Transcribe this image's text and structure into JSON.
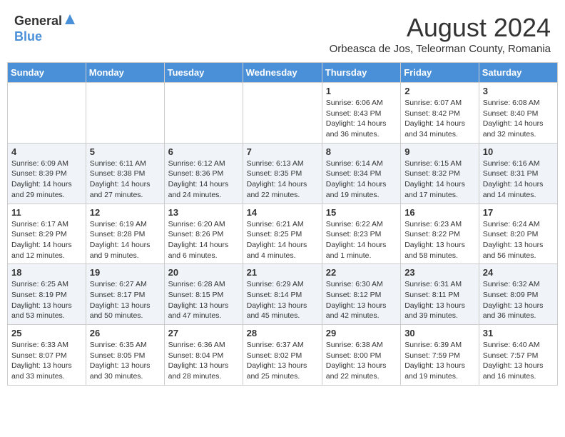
{
  "header": {
    "logo_general": "General",
    "logo_blue": "Blue",
    "main_title": "August 2024",
    "subtitle": "Orbeasca de Jos, Teleorman County, Romania"
  },
  "days_of_week": [
    "Sunday",
    "Monday",
    "Tuesday",
    "Wednesday",
    "Thursday",
    "Friday",
    "Saturday"
  ],
  "weeks": [
    [
      {
        "day": "",
        "content": ""
      },
      {
        "day": "",
        "content": ""
      },
      {
        "day": "",
        "content": ""
      },
      {
        "day": "",
        "content": ""
      },
      {
        "day": "1",
        "content": "Sunrise: 6:06 AM\nSunset: 8:43 PM\nDaylight: 14 hours and 36 minutes."
      },
      {
        "day": "2",
        "content": "Sunrise: 6:07 AM\nSunset: 8:42 PM\nDaylight: 14 hours and 34 minutes."
      },
      {
        "day": "3",
        "content": "Sunrise: 6:08 AM\nSunset: 8:40 PM\nDaylight: 14 hours and 32 minutes."
      }
    ],
    [
      {
        "day": "4",
        "content": "Sunrise: 6:09 AM\nSunset: 8:39 PM\nDaylight: 14 hours and 29 minutes."
      },
      {
        "day": "5",
        "content": "Sunrise: 6:11 AM\nSunset: 8:38 PM\nDaylight: 14 hours and 27 minutes."
      },
      {
        "day": "6",
        "content": "Sunrise: 6:12 AM\nSunset: 8:36 PM\nDaylight: 14 hours and 24 minutes."
      },
      {
        "day": "7",
        "content": "Sunrise: 6:13 AM\nSunset: 8:35 PM\nDaylight: 14 hours and 22 minutes."
      },
      {
        "day": "8",
        "content": "Sunrise: 6:14 AM\nSunset: 8:34 PM\nDaylight: 14 hours and 19 minutes."
      },
      {
        "day": "9",
        "content": "Sunrise: 6:15 AM\nSunset: 8:32 PM\nDaylight: 14 hours and 17 minutes."
      },
      {
        "day": "10",
        "content": "Sunrise: 6:16 AM\nSunset: 8:31 PM\nDaylight: 14 hours and 14 minutes."
      }
    ],
    [
      {
        "day": "11",
        "content": "Sunrise: 6:17 AM\nSunset: 8:29 PM\nDaylight: 14 hours and 12 minutes."
      },
      {
        "day": "12",
        "content": "Sunrise: 6:19 AM\nSunset: 8:28 PM\nDaylight: 14 hours and 9 minutes."
      },
      {
        "day": "13",
        "content": "Sunrise: 6:20 AM\nSunset: 8:26 PM\nDaylight: 14 hours and 6 minutes."
      },
      {
        "day": "14",
        "content": "Sunrise: 6:21 AM\nSunset: 8:25 PM\nDaylight: 14 hours and 4 minutes."
      },
      {
        "day": "15",
        "content": "Sunrise: 6:22 AM\nSunset: 8:23 PM\nDaylight: 14 hours and 1 minute."
      },
      {
        "day": "16",
        "content": "Sunrise: 6:23 AM\nSunset: 8:22 PM\nDaylight: 13 hours and 58 minutes."
      },
      {
        "day": "17",
        "content": "Sunrise: 6:24 AM\nSunset: 8:20 PM\nDaylight: 13 hours and 56 minutes."
      }
    ],
    [
      {
        "day": "18",
        "content": "Sunrise: 6:25 AM\nSunset: 8:19 PM\nDaylight: 13 hours and 53 minutes."
      },
      {
        "day": "19",
        "content": "Sunrise: 6:27 AM\nSunset: 8:17 PM\nDaylight: 13 hours and 50 minutes."
      },
      {
        "day": "20",
        "content": "Sunrise: 6:28 AM\nSunset: 8:15 PM\nDaylight: 13 hours and 47 minutes."
      },
      {
        "day": "21",
        "content": "Sunrise: 6:29 AM\nSunset: 8:14 PM\nDaylight: 13 hours and 45 minutes."
      },
      {
        "day": "22",
        "content": "Sunrise: 6:30 AM\nSunset: 8:12 PM\nDaylight: 13 hours and 42 minutes."
      },
      {
        "day": "23",
        "content": "Sunrise: 6:31 AM\nSunset: 8:11 PM\nDaylight: 13 hours and 39 minutes."
      },
      {
        "day": "24",
        "content": "Sunrise: 6:32 AM\nSunset: 8:09 PM\nDaylight: 13 hours and 36 minutes."
      }
    ],
    [
      {
        "day": "25",
        "content": "Sunrise: 6:33 AM\nSunset: 8:07 PM\nDaylight: 13 hours and 33 minutes."
      },
      {
        "day": "26",
        "content": "Sunrise: 6:35 AM\nSunset: 8:05 PM\nDaylight: 13 hours and 30 minutes."
      },
      {
        "day": "27",
        "content": "Sunrise: 6:36 AM\nSunset: 8:04 PM\nDaylight: 13 hours and 28 minutes."
      },
      {
        "day": "28",
        "content": "Sunrise: 6:37 AM\nSunset: 8:02 PM\nDaylight: 13 hours and 25 minutes."
      },
      {
        "day": "29",
        "content": "Sunrise: 6:38 AM\nSunset: 8:00 PM\nDaylight: 13 hours and 22 minutes."
      },
      {
        "day": "30",
        "content": "Sunrise: 6:39 AM\nSunset: 7:59 PM\nDaylight: 13 hours and 19 minutes."
      },
      {
        "day": "31",
        "content": "Sunrise: 6:40 AM\nSunset: 7:57 PM\nDaylight: 13 hours and 16 minutes."
      }
    ]
  ]
}
